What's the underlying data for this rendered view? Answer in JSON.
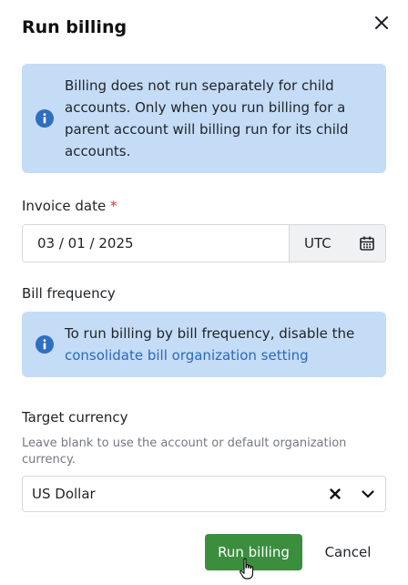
{
  "dialog": {
    "title": "Run billing",
    "close_icon": "close-icon"
  },
  "notice": {
    "icon": "info-icon",
    "text": "Billing does not run separately for child accounts. Only when you run billing for a parent account will billing run for its child accounts."
  },
  "invoice_date": {
    "label": "Invoice date",
    "required_marker": "*",
    "value": "03 / 01 / 2025",
    "timezone": "UTC",
    "calendar_icon": "calendar-icon"
  },
  "bill_frequency": {
    "label": "Bill frequency",
    "icon": "info-icon",
    "text_prefix": "To run billing by bill frequency, disable the",
    "link_text": "consolidate bill organization setting"
  },
  "target_currency": {
    "label": "Target currency",
    "hint": "Leave blank to use the account or default organization currency.",
    "value": "US Dollar",
    "clear_icon": "clear-x-icon",
    "dropdown_icon": "chevron-down-icon"
  },
  "actions": {
    "primary_label": "Run billing",
    "secondary_label": "Cancel",
    "primary_color": "#3c8e3f"
  },
  "colors": {
    "info_background": "#c5dcf6",
    "info_icon": "#2f6fbf",
    "link": "#2a6ab8",
    "required": "#d9302c"
  }
}
